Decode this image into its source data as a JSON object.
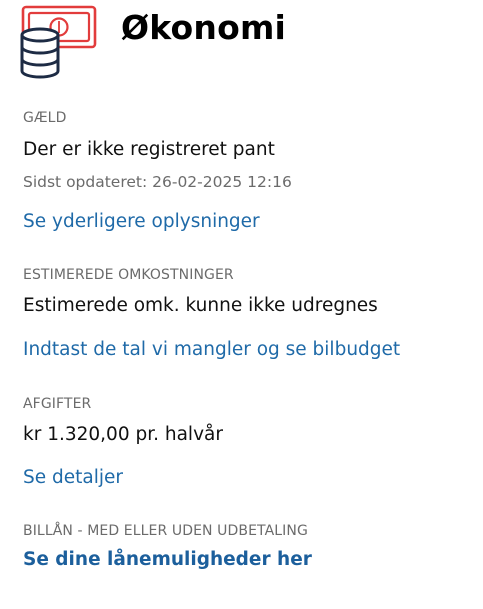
{
  "header": {
    "title": "Økonomi",
    "icon": "money-icon"
  },
  "colors": {
    "accent_red": "#e23c3c",
    "navy": "#1d2b44",
    "link_blue": "#1f6aa8",
    "label_gray": "#6b6b6b"
  },
  "sections": {
    "debt": {
      "label": "GÆLD",
      "value": "Der er ikke registreret pant",
      "updated": "Sidst opdateret: 26-02-2025 12:16",
      "link": "Se yderligere oplysninger"
    },
    "costs": {
      "label": "ESTIMEREDE OMKOSTNINGER",
      "value": "Estimerede omk. kunne ikke udregnes",
      "link": "Indtast de tal vi mangler og se bilbudget"
    },
    "fees": {
      "label": "AFGIFTER",
      "value": "kr 1.320,00 pr. halvår",
      "link": "Se detaljer"
    },
    "loan": {
      "label": "BILLÅN - MED ELLER UDEN UDBETALING",
      "link": "Se dine lånemuligheder her"
    }
  }
}
